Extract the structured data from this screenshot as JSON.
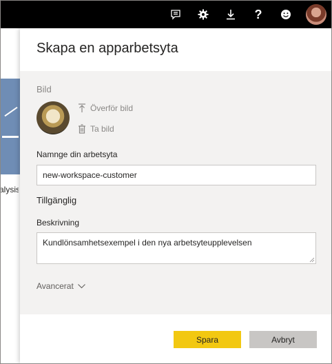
{
  "topbar": {
    "icons": [
      "feedback-icon",
      "settings-icon",
      "download-icon",
      "help-icon",
      "smiley-icon"
    ],
    "help_glyph": "?"
  },
  "background": {
    "tile_caption": "alysis"
  },
  "panel": {
    "title": "Skapa en apparbetsyta",
    "image_label": "Bild",
    "upload_label": "Överför bild",
    "delete_label": "Ta bild",
    "name_label": "Namnge din arbetsyta",
    "name_value": "new-workspace-customer",
    "availability_label": "Tillgänglig",
    "description_label": "Beskrivning",
    "description_value": "Kundlönsamhetsexempel i den nya arbetsyteupplevelsen",
    "advanced_label": "Avancerat"
  },
  "buttons": {
    "save_label": "Spara",
    "cancel_label": "Avbryt"
  },
  "colors": {
    "topbar": "#000000",
    "panel_body": "#f3f2f1",
    "save_button": "#f2c811",
    "cancel_button": "#c8c6c4",
    "tile": "#6f8db5"
  }
}
